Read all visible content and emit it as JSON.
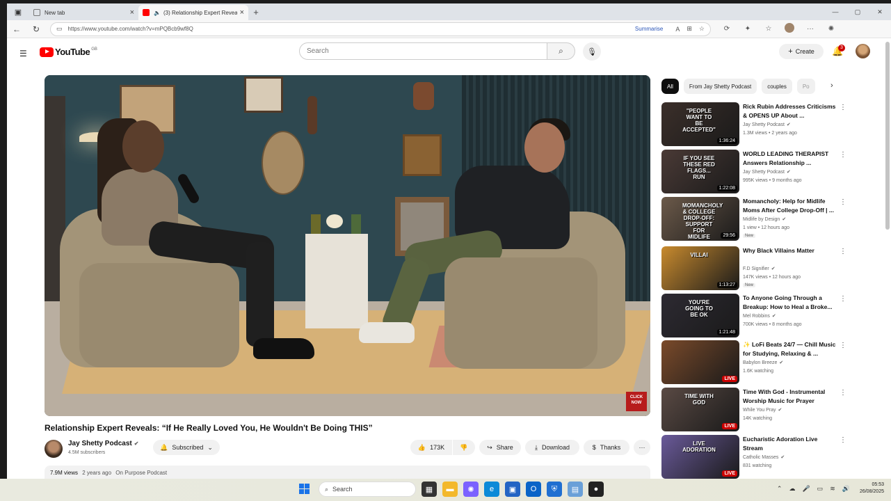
{
  "browser": {
    "tabs": [
      {
        "title": "New tab",
        "close": "×"
      },
      {
        "title": "(3) Relationship Expert Revea",
        "close": "×"
      }
    ],
    "new_tab": "+",
    "window_controls": {
      "minimize": "—",
      "maximize": "▢",
      "close": "✕"
    },
    "url": "https://www.youtube.com/watch?v=mPQBcb9wf8Q",
    "summarise": "Summarise"
  },
  "youtube": {
    "logo_text": "YouTube",
    "logo_country": "GB",
    "search_placeholder": "Search",
    "create_label": "Create",
    "notifications_count": "3"
  },
  "video": {
    "title": "Relationship Expert Reveals: “If He Really Loved You, He Wouldn't Be Doing THIS”",
    "corner_logo": "CLICK NOW",
    "channel": {
      "name": "Jay Shetty Podcast",
      "subscribers": "4.5M subscribers",
      "subscribed_label": "Subscribed"
    },
    "actions": {
      "likes": "173K",
      "share": "Share",
      "download": "Download",
      "thanks": "Thanks",
      "more": "···"
    },
    "description": {
      "views": "7.9M views",
      "age": "2 years ago",
      "tag": "On Purpose Podcast"
    }
  },
  "chips": [
    "All",
    "From Jay Shetty Podcast",
    "couples",
    "Po"
  ],
  "recommendations": [
    {
      "title": "Rick Rubin Addresses Criticisms & OPENS UP About ...",
      "channel": "Jay Shetty Podcast",
      "meta": "1.3M views • 2 years ago",
      "duration": "1:36:24",
      "overlay": "\"PEOPLE WANT TO BE ACCEPTED\"",
      "color": "#3b2f2a"
    },
    {
      "title": "WORLD LEADING THERAPIST Answers Relationship ...",
      "channel": "Jay Shetty Podcast",
      "meta": "995K views • 9 months ago",
      "duration": "1:22:08",
      "overlay": "IF YOU SEE THESE RED FLAGS... RUN",
      "color": "#4a3a36"
    },
    {
      "title": "Momancholy: Help for Midlife Moms After College Drop-Off | ...",
      "channel": "Midlife by Design",
      "meta": "1 view • 12 hours ago",
      "duration": "29:56",
      "overlay": "MOMANCHOLY & COLLEGE DROP-OFF: SUPPORT FOR MIDLIFE MOMS",
      "badge": "New",
      "color": "#6c5a4a"
    },
    {
      "title": "Why Black Villains Matter",
      "channel": "F.D Signifier",
      "meta": "147K views • 12 hours ago",
      "duration": "1:13:27",
      "overlay": "VILLAI",
      "badge": "New",
      "color": "#c98b2e"
    },
    {
      "title": "To Anyone Going Through a Breakup: How to Heal a Broke...",
      "channel": "Mel Robbins",
      "meta": "700K views • 8 months ago",
      "duration": "1:21:48",
      "overlay": "YOU'RE GOING TO BE OK",
      "color": "#2d2a32"
    },
    {
      "title": "✨ LoFi Beats 24/7 — Chill Music for Studying, Relaxing & ...",
      "channel": "Babylon Breeze",
      "meta": "1.6K watching",
      "live": "LIVE",
      "overlay": "",
      "color": "#7a4a2a"
    },
    {
      "title": "Time With God - Instrumental Worship Music for Prayer",
      "channel": "While You Pray",
      "meta": "14K watching",
      "live": "LIVE",
      "overlay": "TIME WITH GOD",
      "color": "#5a4a44"
    },
    {
      "title": "Eucharistic Adoration Live Stream",
      "channel": "Catholic Masses",
      "meta": "831 watching",
      "live": "LIVE",
      "overlay": "LIVE ADORATION",
      "color": "#6a5a9a"
    }
  ],
  "taskbar": {
    "search": "Search",
    "time": "05:53",
    "date": "26/08/2025"
  }
}
